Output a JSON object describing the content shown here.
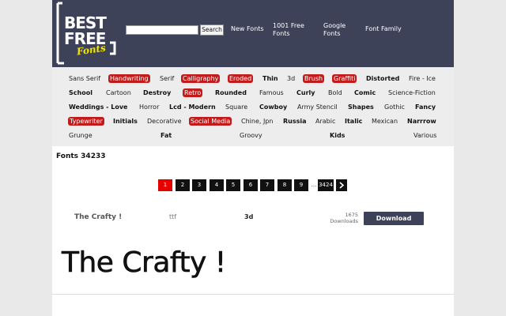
{
  "header": {
    "logo_text": [
      "BEST",
      "FREE",
      "Fonts"
    ],
    "search": {
      "placeholder": "",
      "value": "",
      "button_label": "Search"
    },
    "nav": [
      "New Fonts",
      "1001 Free Fonts",
      "Google Fonts",
      "Font Family"
    ]
  },
  "categories": {
    "rows": [
      [
        {
          "label": "Sans Serif",
          "style": "normal"
        },
        {
          "label": "Handwriting",
          "style": "red"
        },
        {
          "label": "Serif",
          "style": "normal"
        },
        {
          "label": "Calligraphy",
          "style": "red"
        },
        {
          "label": "Eroded",
          "style": "red"
        },
        {
          "label": "Thin",
          "style": "bold"
        },
        {
          "label": "3d",
          "style": "normal"
        },
        {
          "label": "Brush",
          "style": "red"
        },
        {
          "label": "Graffiti",
          "style": "red"
        },
        {
          "label": "Distorted",
          "style": "bold"
        },
        {
          "label": "Fire - Ice",
          "style": "normal"
        }
      ],
      [
        {
          "label": "School",
          "style": "bold"
        },
        {
          "label": "Cartoon",
          "style": "normal"
        },
        {
          "label": "Destroy",
          "style": "bold"
        },
        {
          "label": "Retro",
          "style": "red"
        },
        {
          "label": "Rounded",
          "style": "bold"
        },
        {
          "label": "Famous",
          "style": "normal"
        },
        {
          "label": "Curly",
          "style": "bold"
        },
        {
          "label": "Bold",
          "style": "normal"
        },
        {
          "label": "Comic",
          "style": "bold"
        },
        {
          "label": "Science-Fiction",
          "style": "normal"
        }
      ],
      [
        {
          "label": "Weddings - Love",
          "style": "bold"
        },
        {
          "label": "Horror",
          "style": "normal"
        },
        {
          "label": "Lcd - Modern",
          "style": "bold"
        },
        {
          "label": "Square",
          "style": "normal"
        },
        {
          "label": "Cowboy",
          "style": "bold"
        },
        {
          "label": "Army Stencil",
          "style": "normal"
        },
        {
          "label": "Shapes",
          "style": "bold"
        },
        {
          "label": "Gothic",
          "style": "normal"
        },
        {
          "label": "Fancy",
          "style": "bold"
        }
      ],
      [
        {
          "label": "Typewriter",
          "style": "red"
        },
        {
          "label": "Initials",
          "style": "bold"
        },
        {
          "label": "Decorative",
          "style": "normal"
        },
        {
          "label": "Social Media",
          "style": "red"
        },
        {
          "label": "Chine, Jpn",
          "style": "normal"
        },
        {
          "label": "Russia",
          "style": "bold"
        },
        {
          "label": "Arabic",
          "style": "normal"
        },
        {
          "label": "Italic",
          "style": "bold"
        },
        {
          "label": "Mexican",
          "style": "normal"
        },
        {
          "label": "Narrrow",
          "style": "bold"
        }
      ],
      [
        {
          "label": "Grunge",
          "style": "normal"
        },
        {
          "label": "Fat",
          "style": "bold"
        },
        {
          "label": "Groovy",
          "style": "normal"
        },
        {
          "label": "Kids",
          "style": "bold"
        },
        {
          "label": "Various",
          "style": "normal"
        }
      ]
    ]
  },
  "main": {
    "fonts_count": "Fonts 34233",
    "pagination": {
      "pages": [
        "1",
        "2",
        "3",
        "4",
        "5",
        "6",
        "7",
        "8",
        "9"
      ],
      "active": "1",
      "ellipsis": "...",
      "last": "3424"
    },
    "font_item": {
      "name": "The Crafty !",
      "type": "ttf",
      "category": "3d",
      "downloads_count": "1675",
      "downloads_label": "Downloads",
      "download_button": "Download",
      "preview_text": "The Crafty !"
    }
  },
  "colors": {
    "header_bg": "#3e4259",
    "accent_red": "#c21b1b",
    "active_page": "#e60000"
  }
}
